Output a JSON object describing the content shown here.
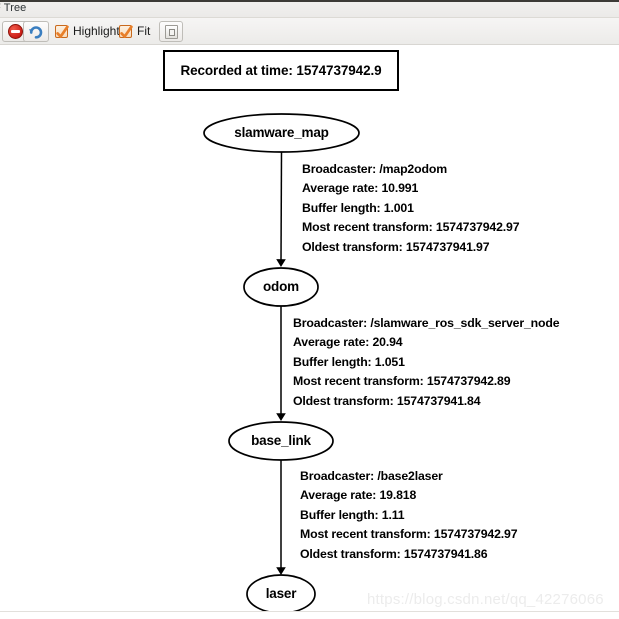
{
  "window": {
    "title": "F Tree"
  },
  "toolbar": {
    "stop_icon": "stop-icon",
    "refresh_icon": "refresh-icon",
    "highlight_label": "Highlight",
    "highlight_checked": true,
    "fit_label": "Fit",
    "fit_checked": true,
    "snapshot_icon": "snapshot-icon"
  },
  "graph": {
    "recorded_at": "Recorded at time: 1574737942.9",
    "nodes": [
      {
        "id": "slamware_map",
        "label": "slamware_map"
      },
      {
        "id": "odom",
        "label": "odom"
      },
      {
        "id": "base_link",
        "label": "base_link"
      },
      {
        "id": "laser",
        "label": "laser"
      }
    ],
    "edges": [
      {
        "from": "slamware_map",
        "to": "odom",
        "broadcaster": "Broadcaster: /map2odom",
        "average_rate": "Average rate: 10.991",
        "buffer_length": "Buffer length: 1.001",
        "most_recent_transform": "Most recent transform: 1574737942.97",
        "oldest_transform": "Oldest transform: 1574737941.97"
      },
      {
        "from": "odom",
        "to": "base_link",
        "broadcaster": "Broadcaster: /slamware_ros_sdk_server_node",
        "average_rate": "Average rate: 20.94",
        "buffer_length": "Buffer length: 1.051",
        "most_recent_transform": "Most recent transform: 1574737942.89",
        "oldest_transform": "Oldest transform: 1574737941.84"
      },
      {
        "from": "base_link",
        "to": "laser",
        "broadcaster": "Broadcaster: /base2laser",
        "average_rate": "Average rate: 19.818",
        "buffer_length": "Buffer length: 1.11",
        "most_recent_transform": "Most recent transform: 1574737942.97",
        "oldest_transform": "Oldest transform: 1574737941.86"
      }
    ]
  },
  "watermark": {
    "text": "https://blog.csdn.net/qq_42276066"
  },
  "colors": {
    "accent_checkbox": "#e87f2a",
    "stop_red": "#cc1f18",
    "refresh_blue": "#3a7ec0",
    "node_stroke": "#000000",
    "canvas_bg": "#ffffff"
  }
}
